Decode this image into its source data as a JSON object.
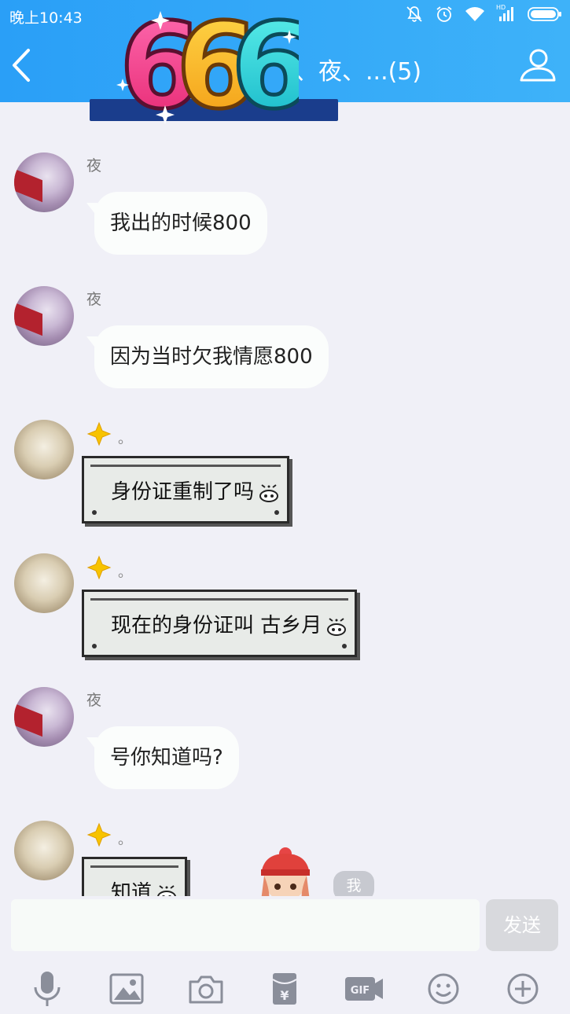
{
  "status_bar": {
    "time": "晚上10:43",
    "hd_label": "HD"
  },
  "header": {
    "title": "。、夜、...(5)"
  },
  "sticker_overlay": {
    "text": "666"
  },
  "messages": [
    {
      "sender": "夜",
      "text": "我出的时候800",
      "style": "plain"
    },
    {
      "sender": "夜",
      "text": "因为当时欠我情愿800",
      "style": "plain"
    },
    {
      "sender": "。",
      "text": "身份证重制了吗",
      "style": "pixel"
    },
    {
      "sender": "。",
      "text": "现在的身份证叫 古乡月",
      "style": "pixel"
    },
    {
      "sender": "夜",
      "text": "号你知道吗?",
      "style": "plain"
    },
    {
      "sender": "。",
      "text": "知道",
      "style": "pixel"
    }
  ],
  "me_tag": "我",
  "composer": {
    "input_value": "",
    "send_label": "发送"
  },
  "toolbar": [
    "microphone-icon",
    "image-icon",
    "camera-icon",
    "red-packet-icon",
    "gif-icon",
    "emoji-icon",
    "plus-icon"
  ],
  "colors": {
    "header_bg": "#2a9ff7",
    "chat_bg": "#f0f0f7",
    "bubble_bg": "#fbfdfc",
    "send_disabled": "#d8d9dd"
  }
}
